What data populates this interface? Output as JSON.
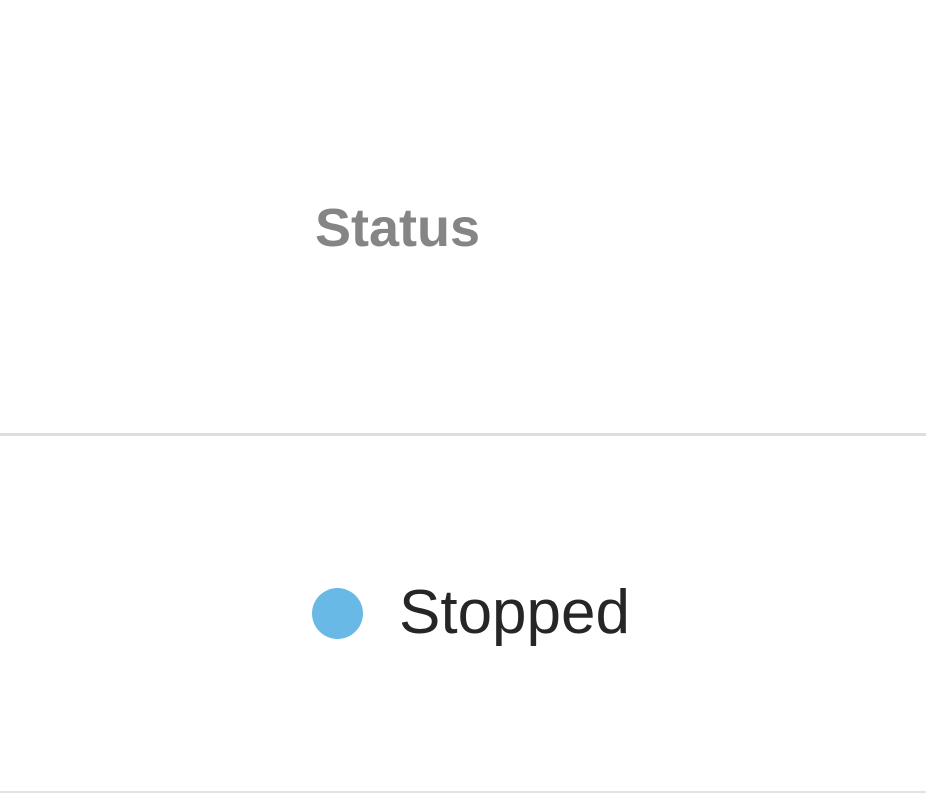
{
  "table": {
    "columns": [
      {
        "header": "Status"
      }
    ],
    "rows": [
      {
        "status": {
          "label": "Stopped",
          "indicator_color": "#68b9e5",
          "indicator_icon": "status-dot-icon"
        }
      }
    ]
  },
  "colors": {
    "header_text": "#858585",
    "cell_text": "#262626",
    "divider": "#dedede"
  }
}
